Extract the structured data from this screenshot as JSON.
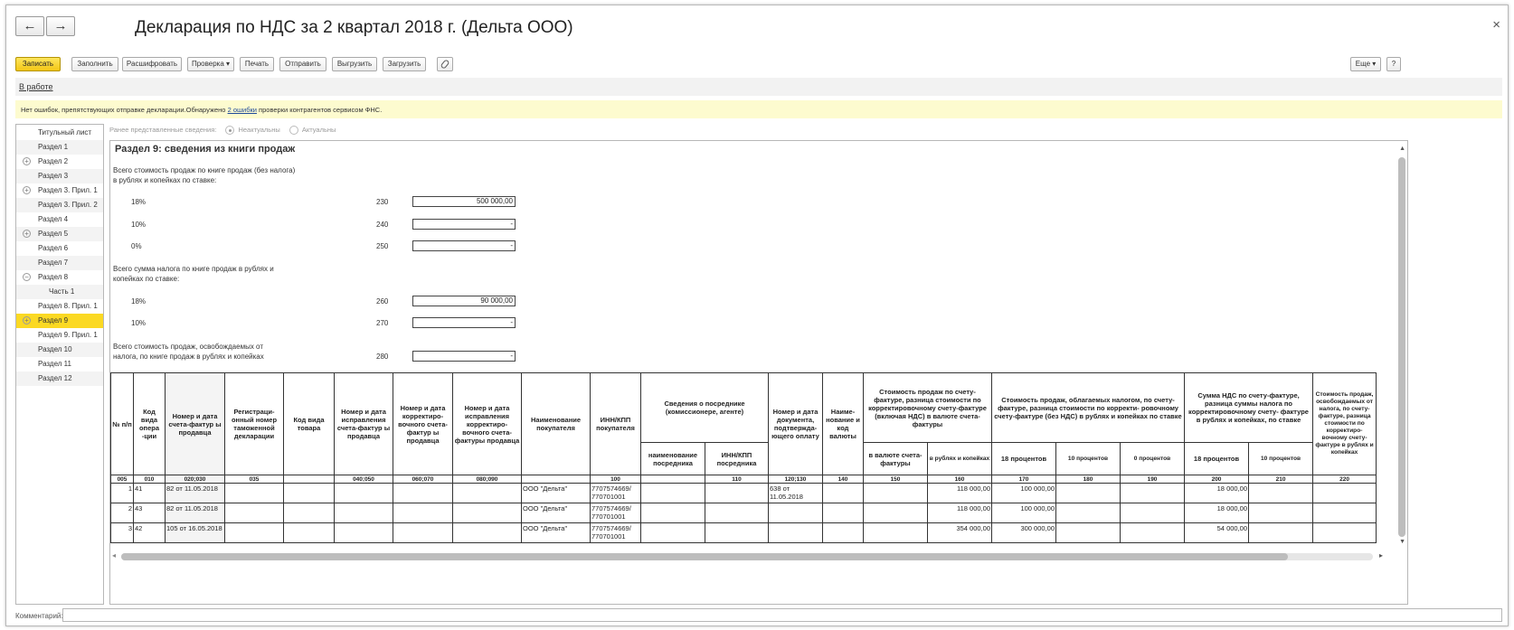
{
  "window": {
    "title": "Декларация по НДС за 2 квартал 2018 г. (Дельта ООО)",
    "back_icon": "←",
    "forward_icon": "→",
    "close_icon": "×"
  },
  "toolbar": {
    "save": "Записать",
    "fill": "Заполнить",
    "decode": "Расшифровать",
    "check": "Проверка ▾",
    "print": "Печать",
    "send": "Отправить",
    "export": "Выгрузить",
    "import": "Загрузить",
    "more": "Еще ▾",
    "help": "?"
  },
  "status": {
    "link": "В работе"
  },
  "message": {
    "text_before": "Нет ошибок, препятствующих отправке декларации.Обнаружено ",
    "link": "2 ошибки",
    "text_after": " проверки контрагентов сервисом ФНС."
  },
  "nav": {
    "items": [
      {
        "label": "Титульный лист",
        "pm": ""
      },
      {
        "label": "Раздел 1",
        "pm": ""
      },
      {
        "label": "Раздел 2",
        "pm": "+"
      },
      {
        "label": "Раздел 3",
        "pm": ""
      },
      {
        "label": "Раздел 3. Прил. 1",
        "pm": "+"
      },
      {
        "label": "Раздел 3. Прил. 2",
        "pm": ""
      },
      {
        "label": "Раздел 4",
        "pm": ""
      },
      {
        "label": "Раздел 5",
        "pm": "+"
      },
      {
        "label": "Раздел 6",
        "pm": ""
      },
      {
        "label": "Раздел 7",
        "pm": ""
      },
      {
        "label": "Раздел 8",
        "pm": "−"
      },
      {
        "label": "Часть 1",
        "pm": ""
      },
      {
        "label": "Раздел 8. Прил. 1",
        "pm": ""
      },
      {
        "label": "Раздел 9",
        "pm": "+"
      },
      {
        "label": "Раздел 9. Прил. 1",
        "pm": ""
      },
      {
        "label": "Раздел 10",
        "pm": ""
      },
      {
        "label": "Раздел 11",
        "pm": ""
      },
      {
        "label": "Раздел 12",
        "pm": ""
      }
    ]
  },
  "previous": {
    "label": "Ранее представленные сведения:",
    "opt1": "Неактуальны",
    "opt2": "Актуальны"
  },
  "section": {
    "title": "Раздел 9: сведения из книги продаж",
    "block1_line1": "Всего стоимость продаж по книге продаж (без налога)",
    "block1_line2": "в рублях и копейках по ставке:",
    "block2_line1": "Всего сумма налога по книге продаж в рублях и",
    "block2_line2": "копейках по ставке:",
    "block3_line1": "Всего стоимость продаж, освобождаемых от",
    "block3_line2": "налога, по книге продаж в рублях и копейках",
    "rows": [
      {
        "rate": "18%",
        "code": "230",
        "value": "500 000,00"
      },
      {
        "rate": "10%",
        "code": "240",
        "value": "-"
      },
      {
        "rate": "0%",
        "code": "250",
        "value": "-"
      },
      {
        "rate": "18%",
        "code": "260",
        "value": "90 000,00"
      },
      {
        "rate": "10%",
        "code": "270",
        "value": "-"
      },
      {
        "rate": "",
        "code": "280",
        "value": "-"
      }
    ]
  },
  "table": {
    "headers": {
      "h1": "№ п/п",
      "h2": "Код вида опера -ции",
      "h3": "Номер и дата счета-фактур ы продавца",
      "h4": "Регистраци- онный номер таможенной декларации",
      "h5": "Код вида товара",
      "h6": "Номер и дата исправления счета-фактур ы продавца",
      "h7": "Номер и дата корректиро- вочного счета-фактур ы продавца",
      "h8": "Номер и дата исправления корректиро- вочного счета-фактуры продавца",
      "h9": "Наименование покупателя",
      "h10": "ИНН/КПП покупателя",
      "h11": "Сведения о посреднике (комиссионере, агенте)",
      "h11a": "наименование посредника",
      "h11b": "ИНН/КПП посредника",
      "h12": "Номер и дата документа, подтвержда- ющего оплату",
      "h13": "Наиме- нование и код валюты",
      "h14": "Стоимость продаж по счету-фактуре, разница стоимости по корректировочному счету-фактуре (включая НДС) в валюте счета-фактуры",
      "h14a": "в валюте счета-фактуры",
      "h14b": "в рублях и копейках",
      "h15": "Стоимость продаж, облагаемых налогом, по счету-фактуре, разница стоимости по корректи- ровочному счету-фактуре (без НДС) в рублях и копейках по ставке",
      "h15a": "18 процентов",
      "h15b": "10 процентов",
      "h15c": "0 процентов",
      "h16": "Сумма НДС по счету-фактуре, разница суммы налога по корректировочному счету- фактуре в рублях и копейках, по ставке",
      "h16a": "18 процентов",
      "h16b": "10 процентов",
      "h17": "Стоимость продаж, освобождаемых от налога, по счету-фактуре, разница стоимости по корректиро- вочному счету-фактуре в рублях и копейках"
    },
    "codes": [
      "005",
      "010",
      "020;030",
      "035",
      "",
      "040;050",
      "060;070",
      "080;090",
      "",
      "100",
      "",
      "110",
      "120;130",
      "140",
      "150",
      "160",
      "170",
      "180",
      "190",
      "200",
      "210",
      "220"
    ],
    "rows": [
      [
        "1",
        "41",
        "82 от 11.05.2018",
        "",
        "",
        "",
        "",
        "",
        "ООО \"Дельта\"",
        "7707574669/ 770701001",
        "",
        "",
        "638 от 11.05.2018",
        "",
        "",
        "118 000,00",
        "100 000,00",
        "",
        "",
        "18 000,00",
        "",
        ""
      ],
      [
        "2",
        "43",
        "82 от 11.05.2018",
        "",
        "",
        "",
        "",
        "",
        "ООО \"Дельта\"",
        "7707574669/ 770701001",
        "",
        "",
        "",
        "",
        "",
        "118 000,00",
        "100 000,00",
        "",
        "",
        "18 000,00",
        "",
        ""
      ],
      [
        "3",
        "42",
        "105 от 16.05.2018",
        "",
        "",
        "",
        "",
        "",
        "ООО \"Дельта\"",
        "7707574669/ 770701001",
        "",
        "",
        "",
        "",
        "",
        "354 000,00",
        "300 000,00",
        "",
        "",
        "54 000,00",
        "",
        ""
      ]
    ]
  },
  "comment": {
    "label": "Комментарий:",
    "value": ""
  }
}
